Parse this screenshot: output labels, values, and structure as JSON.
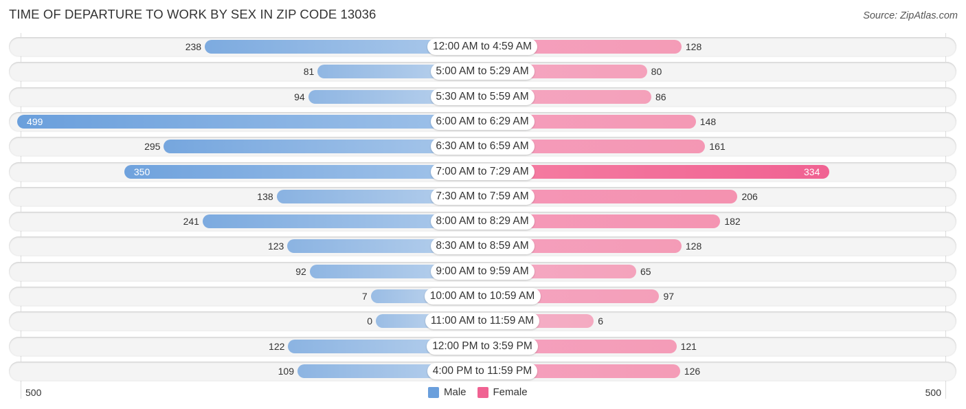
{
  "colors": {
    "male": "#6a9fdc",
    "female": "#f06292",
    "male_strong": "#5d95da",
    "female_strong": "#f06292"
  },
  "chart_data": {
    "type": "bar",
    "orientation": "horizontal-diverging",
    "title": "TIME OF DEPARTURE TO WORK BY SEX IN ZIP CODE 13036",
    "source": "Source: ZipAtlas.com",
    "categories": [
      "12:00 AM to 4:59 AM",
      "5:00 AM to 5:29 AM",
      "5:30 AM to 5:59 AM",
      "6:00 AM to 6:29 AM",
      "6:30 AM to 6:59 AM",
      "7:00 AM to 7:29 AM",
      "7:30 AM to 7:59 AM",
      "8:00 AM to 8:29 AM",
      "8:30 AM to 8:59 AM",
      "9:00 AM to 9:59 AM",
      "10:00 AM to 10:59 AM",
      "11:00 AM to 11:59 AM",
      "12:00 PM to 3:59 PM",
      "4:00 PM to 11:59 PM"
    ],
    "series": [
      {
        "name": "Male",
        "values": [
          238,
          81,
          94,
          499,
          295,
          350,
          138,
          241,
          123,
          92,
          7,
          0,
          122,
          109
        ]
      },
      {
        "name": "Female",
        "values": [
          128,
          80,
          86,
          148,
          161,
          334,
          206,
          182,
          128,
          65,
          97,
          6,
          121,
          126
        ]
      }
    ],
    "axis": {
      "left_tick": "500",
      "right_tick": "500",
      "range": [
        0,
        500
      ]
    },
    "legend": {
      "items": [
        "Male",
        "Female"
      ],
      "position": "bottom-center"
    }
  }
}
